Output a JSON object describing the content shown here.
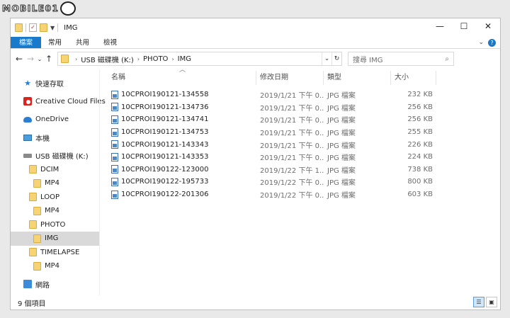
{
  "watermark": {
    "text": "MOBILE01"
  },
  "window": {
    "title": "IMG",
    "controls": {
      "minimize": "—",
      "maximize": "☐",
      "close": "✕"
    }
  },
  "ribbon": {
    "tabs": [
      "檔案",
      "常用",
      "共用",
      "檢視"
    ],
    "expand": "⌄",
    "help": "?"
  },
  "navbar": {
    "back": "←",
    "forward": "→",
    "recent": "⌄",
    "up": "↑",
    "breadcrumb": [
      "USB 磁碟機 (K:)",
      "PHOTO",
      "IMG"
    ],
    "search_placeholder": "搜尋 IMG"
  },
  "sidebar": {
    "items": [
      {
        "label": "快速存取",
        "icon": "star-icon"
      },
      {
        "label": "Creative Cloud Files",
        "icon": "creative-cloud-icon"
      },
      {
        "label": "OneDrive",
        "icon": "cloud-icon"
      },
      {
        "label": "本機",
        "icon": "computer-icon"
      },
      {
        "label": "USB 磁碟機 (K:)",
        "icon": "drive-icon"
      },
      {
        "label": "DCIM",
        "icon": "folder-icon"
      },
      {
        "label": "MP4",
        "icon": "folder-icon"
      },
      {
        "label": "LOOP",
        "icon": "folder-icon"
      },
      {
        "label": "MP4",
        "icon": "folder-icon"
      },
      {
        "label": "PHOTO",
        "icon": "folder-icon"
      },
      {
        "label": "IMG",
        "icon": "folder-icon"
      },
      {
        "label": "TIMELAPSE",
        "icon": "folder-icon"
      },
      {
        "label": "MP4",
        "icon": "folder-icon"
      },
      {
        "label": "網路",
        "icon": "network-icon"
      }
    ]
  },
  "columns": {
    "name": "名稱",
    "date": "修改日期",
    "type": "類型",
    "size": "大小"
  },
  "files": [
    {
      "name": "10CPROI190121-134558",
      "date": "2019/1/21 下午 0...",
      "type": "JPG 檔案",
      "size": "232 KB"
    },
    {
      "name": "10CPROI190121-134736",
      "date": "2019/1/21 下午 0...",
      "type": "JPG 檔案",
      "size": "256 KB"
    },
    {
      "name": "10CPROI190121-134741",
      "date": "2019/1/21 下午 0...",
      "type": "JPG 檔案",
      "size": "256 KB"
    },
    {
      "name": "10CPROI190121-134753",
      "date": "2019/1/21 下午 0...",
      "type": "JPG 檔案",
      "size": "255 KB"
    },
    {
      "name": "10CPROI190121-143343",
      "date": "2019/1/21 下午 0...",
      "type": "JPG 檔案",
      "size": "226 KB"
    },
    {
      "name": "10CPROI190121-143353",
      "date": "2019/1/21 下午 0...",
      "type": "JPG 檔案",
      "size": "224 KB"
    },
    {
      "name": "10CPROI190122-123000",
      "date": "2019/1/22 下午 1...",
      "type": "JPG 檔案",
      "size": "738 KB"
    },
    {
      "name": "10CPROI190122-195733",
      "date": "2019/1/22 下午 0...",
      "type": "JPG 檔案",
      "size": "800 KB"
    },
    {
      "name": "10CPROI190122-201306",
      "date": "2019/1/22 下午 0...",
      "type": "JPG 檔案",
      "size": "603 KB"
    }
  ],
  "status": {
    "count": "9 個項目"
  },
  "colors": {
    "accent": "#1979ca",
    "selected": "#d9d9d9",
    "folder": "#f6d374"
  }
}
